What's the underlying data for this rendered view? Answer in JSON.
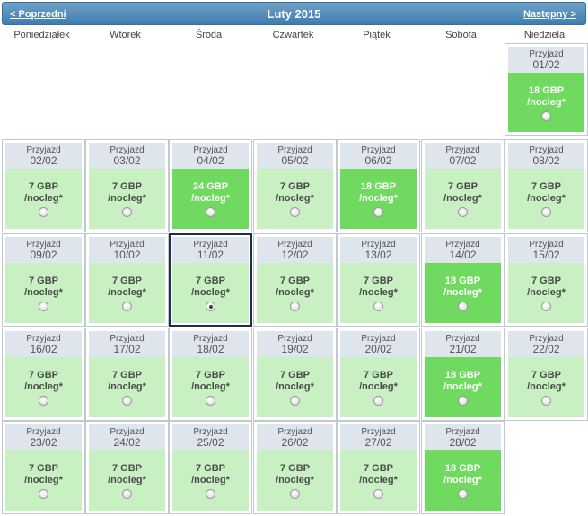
{
  "header": {
    "prev_label": "< Poprzedni",
    "title": "Luty 2015",
    "next_label": "Następny >"
  },
  "weekdays": [
    "Poniedziałek",
    "Wtorek",
    "Środa",
    "Czwartek",
    "Piątek",
    "Sobota",
    "Niedziela"
  ],
  "colors": {
    "header": "#4a86b8",
    "cell_top": "#dfe5ec",
    "price_normal": "#c9f0c3",
    "price_highlight": "#70d960",
    "selected_border": "#1d2f4a"
  },
  "arrival_label": "Przyjazd",
  "per_night_label": "/nocleg*",
  "days": [
    {
      "date": "01/02",
      "price": "18 GBP",
      "highlight": true
    },
    {
      "date": "02/02",
      "price": "7 GBP",
      "highlight": false
    },
    {
      "date": "03/02",
      "price": "7 GBP",
      "highlight": false
    },
    {
      "date": "04/02",
      "price": "24 GBP",
      "highlight": true
    },
    {
      "date": "05/02",
      "price": "7 GBP",
      "highlight": false
    },
    {
      "date": "06/02",
      "price": "18 GBP",
      "highlight": true
    },
    {
      "date": "07/02",
      "price": "7 GBP",
      "highlight": false
    },
    {
      "date": "08/02",
      "price": "7 GBP",
      "highlight": false
    },
    {
      "date": "09/02",
      "price": "7 GBP",
      "highlight": false
    },
    {
      "date": "10/02",
      "price": "7 GBP",
      "highlight": false
    },
    {
      "date": "11/02",
      "price": "7 GBP",
      "highlight": false,
      "selected": true
    },
    {
      "date": "12/02",
      "price": "7 GBP",
      "highlight": false
    },
    {
      "date": "13/02",
      "price": "7 GBP",
      "highlight": false
    },
    {
      "date": "14/02",
      "price": "18 GBP",
      "highlight": true
    },
    {
      "date": "15/02",
      "price": "7 GBP",
      "highlight": false
    },
    {
      "date": "16/02",
      "price": "7 GBP",
      "highlight": false
    },
    {
      "date": "17/02",
      "price": "7 GBP",
      "highlight": false
    },
    {
      "date": "18/02",
      "price": "7 GBP",
      "highlight": false
    },
    {
      "date": "19/02",
      "price": "7 GBP",
      "highlight": false
    },
    {
      "date": "20/02",
      "price": "7 GBP",
      "highlight": false
    },
    {
      "date": "21/02",
      "price": "18 GBP",
      "highlight": true
    },
    {
      "date": "22/02",
      "price": "7 GBP",
      "highlight": false
    },
    {
      "date": "23/02",
      "price": "7 GBP",
      "highlight": false
    },
    {
      "date": "24/02",
      "price": "7 GBP",
      "highlight": false
    },
    {
      "date": "25/02",
      "price": "7 GBP",
      "highlight": false
    },
    {
      "date": "26/02",
      "price": "7 GBP",
      "highlight": false
    },
    {
      "date": "27/02",
      "price": "7 GBP",
      "highlight": false
    },
    {
      "date": "28/02",
      "price": "18 GBP",
      "highlight": true
    }
  ]
}
